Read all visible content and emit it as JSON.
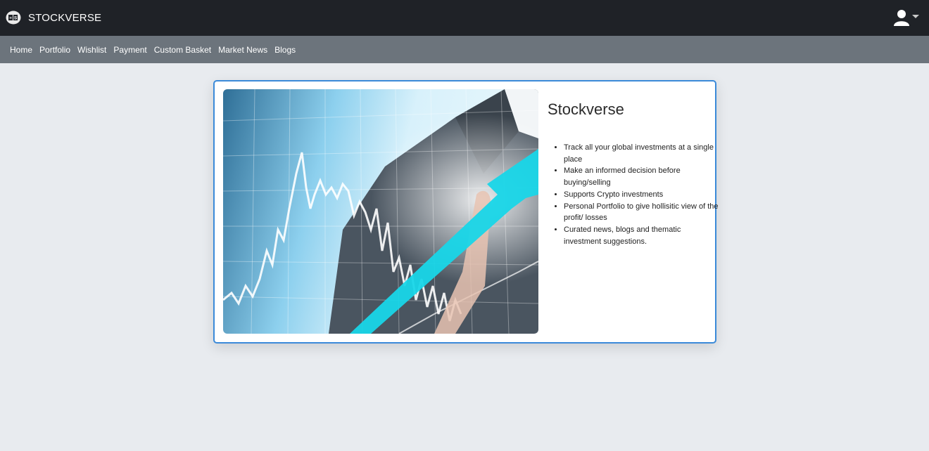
{
  "header": {
    "brand": "STOCKVERSE",
    "logo_text": "SS",
    "user_icon": "user-icon",
    "caret_icon": "caret-down-icon"
  },
  "nav": {
    "items": [
      {
        "label": "Home"
      },
      {
        "label": "Portfolio"
      },
      {
        "label": "Wishlist"
      },
      {
        "label": "Payment"
      },
      {
        "label": "Custom Basket"
      },
      {
        "label": "Market News"
      },
      {
        "label": "Blogs"
      }
    ]
  },
  "card": {
    "title": "Stockverse",
    "image_icon": "stock-chart-hero-image",
    "features": [
      "Track all your global investments at a single place",
      "Make an informed decision before buying/selling",
      "Supports Crypto investments",
      "Personal Portfolio to give hollisitic view of the profit/ losses",
      "Curated news, blogs and thematic investment suggestions."
    ]
  },
  "colors": {
    "topbar": "#1f2227",
    "navbar": "#6c747c",
    "background": "#e8ebef",
    "card_border": "#3b8ad9",
    "arrow": "#18d6e8"
  }
}
